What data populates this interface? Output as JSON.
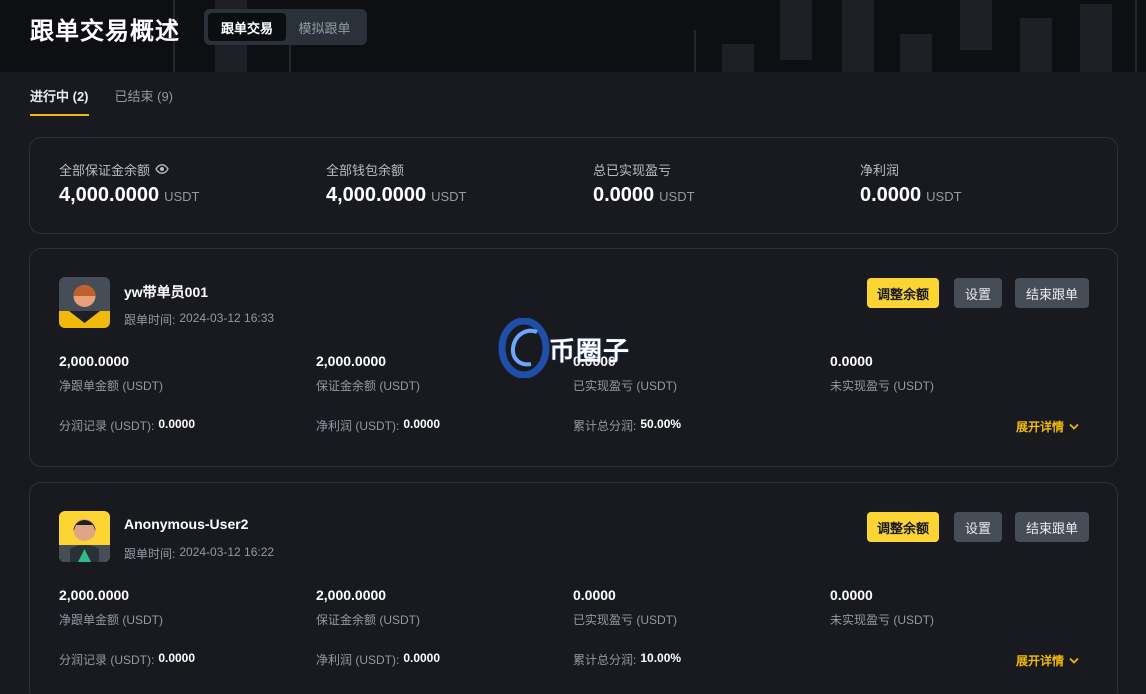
{
  "header": {
    "title": "跟单交易概述",
    "modes": [
      {
        "label": "跟单交易",
        "active": true
      },
      {
        "label": "模拟跟单",
        "active": false
      }
    ]
  },
  "tabs": [
    {
      "label": "进行中 (2)",
      "active": true
    },
    {
      "label": "已结束 (9)",
      "active": false
    }
  ],
  "summary": [
    {
      "label": "全部保证金余额",
      "value": "4,000.0000",
      "unit": "USDT",
      "icon": "eye-icon"
    },
    {
      "label": "全部钱包余额",
      "value": "4,000.0000",
      "unit": "USDT"
    },
    {
      "label": "总已实现盈亏",
      "value": "0.0000",
      "unit": "USDT"
    },
    {
      "label": "净利润",
      "value": "0.0000",
      "unit": "USDT"
    }
  ],
  "cards": [
    {
      "username": "yw带单员001",
      "time_label": "跟单时间:",
      "time": "2024-03-12 16:33",
      "buttons": {
        "adjust": "调整余额",
        "settings": "设置",
        "end": "结束跟单"
      },
      "metrics": [
        {
          "value": "2,000.0000",
          "label": "净跟单金额 (USDT)"
        },
        {
          "value": "2,000.0000",
          "label": "保证金余额 (USDT)"
        },
        {
          "value": "0.0000",
          "label": "已实现盈亏 (USDT)"
        },
        {
          "value": "0.0000",
          "label": "未实现盈亏 (USDT)"
        }
      ],
      "details": [
        {
          "label": "分润记录 (USDT):",
          "value": "0.0000"
        },
        {
          "label": "净利润 (USDT):",
          "value": "0.0000"
        },
        {
          "label": "累计总分润:",
          "value": "50.00%"
        }
      ],
      "expand": "展开详情"
    },
    {
      "username": "Anonymous-User2",
      "time_label": "跟单时间:",
      "time": "2024-03-12 16:22",
      "buttons": {
        "adjust": "调整余额",
        "settings": "设置",
        "end": "结束跟单"
      },
      "metrics": [
        {
          "value": "2,000.0000",
          "label": "净跟单金额 (USDT)"
        },
        {
          "value": "2,000.0000",
          "label": "保证金余额 (USDT)"
        },
        {
          "value": "0.0000",
          "label": "已实现盈亏 (USDT)"
        },
        {
          "value": "0.0000",
          "label": "未实现盈亏 (USDT)"
        }
      ],
      "details": [
        {
          "label": "分润记录 (USDT):",
          "value": "0.0000"
        },
        {
          "label": "净利润 (USDT):",
          "value": "0.0000"
        },
        {
          "label": "累计总分润:",
          "value": "10.00%"
        }
      ],
      "expand": "展开详情"
    }
  ],
  "watermark": {
    "text": "币圈子"
  },
  "colors": {
    "accent": "#f0b90b",
    "button_yellow": "#fcd535",
    "background": "#181a20"
  }
}
